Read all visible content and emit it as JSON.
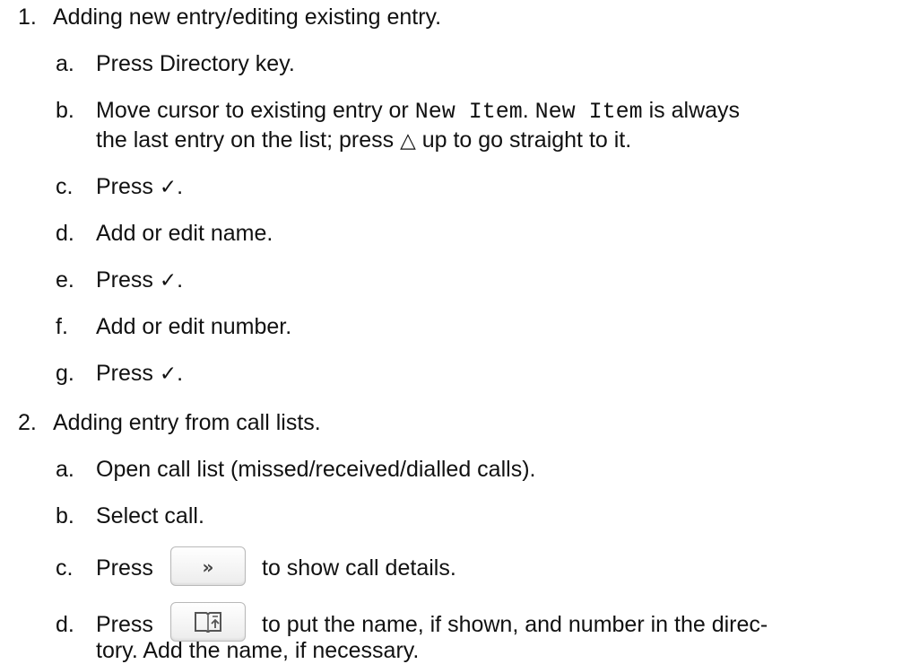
{
  "items": [
    {
      "number": "1.",
      "text": "Adding new entry/editing existing entry.",
      "steps": [
        {
          "letter": "a.",
          "text": "Press Directory key."
        },
        {
          "letter": "b.",
          "text_before": "Move cursor to existing entry or ",
          "code1": "New Item",
          "text_mid": ". ",
          "code2": "New Item",
          "text_after": " is always",
          "line2_before": "the last entry on the list; press ",
          "up_symbol": "△",
          "line2_after": " up to go straight to it."
        },
        {
          "letter": "c.",
          "text": "Press ",
          "check": "✓",
          "end": "."
        },
        {
          "letter": "d.",
          "text": "Add or edit name."
        },
        {
          "letter": "e.",
          "text": "Press ",
          "check": "✓",
          "end": "."
        },
        {
          "letter": "f.",
          "text": "Add or edit number."
        },
        {
          "letter": "g.",
          "text": "Press ",
          "check": "✓",
          "end": "."
        }
      ]
    },
    {
      "number": "2.",
      "text": "Adding entry from call lists.",
      "steps": [
        {
          "letter": "a.",
          "text": "Open call list (missed/received/dialled calls)."
        },
        {
          "letter": "b.",
          "text": "Select call."
        },
        {
          "letter": "c.",
          "text_before": "Press",
          "button_glyph": "»",
          "button_icon": "forward-chevrons-icon",
          "text_after": "to show call details."
        },
        {
          "letter": "d.",
          "text_before": "Press",
          "button_icon": "directory-book-icon",
          "text_after": "to put the name, if shown, and number in the direc-",
          "line2": "tory. Add the name, if necessary."
        }
      ]
    }
  ]
}
